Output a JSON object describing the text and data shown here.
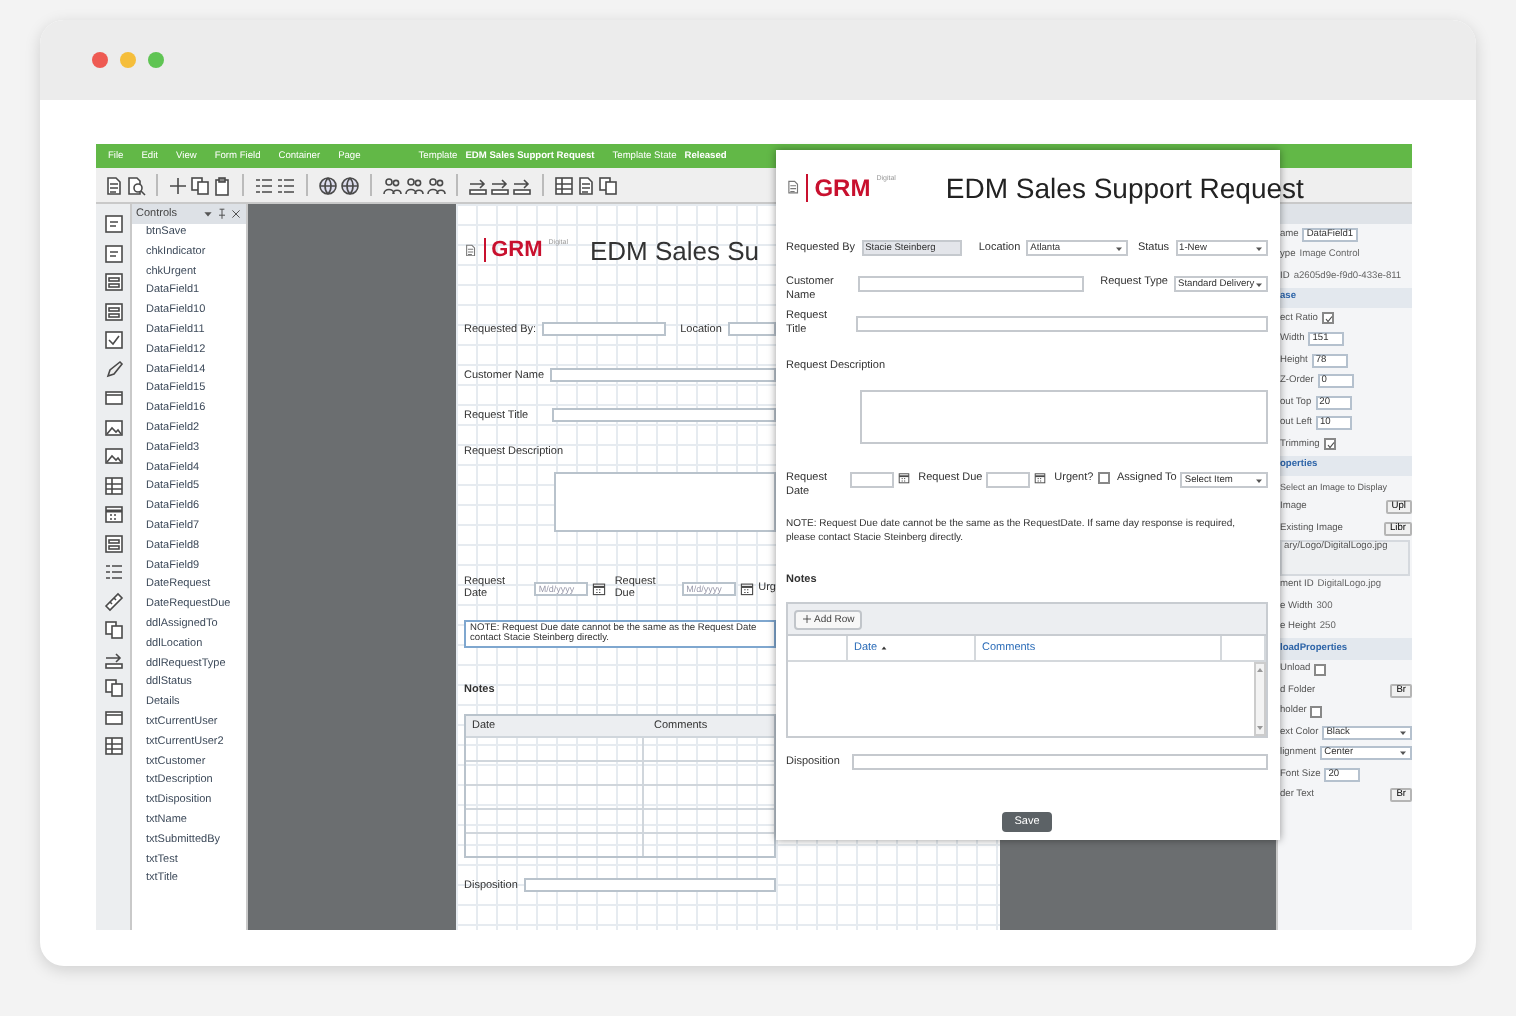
{
  "browser": {
    "dots": [
      {
        "color": "#ee5a52"
      },
      {
        "color": "#f5be3b"
      },
      {
        "color": "#5fc453"
      }
    ]
  },
  "menu_bar": {
    "items": [
      "File",
      "Edit",
      "View",
      "Form Field",
      "Container",
      "Page"
    ],
    "template_label": "Template",
    "template_name": "EDM Sales Support Request",
    "state_label": "Template State",
    "state_value": "Released"
  },
  "controls_panel": {
    "title": "Controls",
    "items": [
      "btnSave",
      "chkIndicator",
      "chkUrgent",
      "DataField1",
      "DataField10",
      "DataField11",
      "DataField12",
      "DataField14",
      "DataField15",
      "DataField16",
      "DataField2",
      "DataField3",
      "DataField4",
      "DataField5",
      "DataField6",
      "DataField7",
      "DataField8",
      "DataField9",
      "DateRequest",
      "DateRequestDue",
      "ddlAssignedTo",
      "ddlLocation",
      "ddlRequestType",
      "ddlStatus",
      "Details",
      "txtCurrentUser",
      "txtCurrentUser2",
      "txtCustomer",
      "txtDescription",
      "txtDisposition",
      "txtName",
      "txtSubmittedBy",
      "txtTest",
      "txtTitle"
    ]
  },
  "form": {
    "logo": {
      "brand": "GRM",
      "tag": "Digital"
    },
    "title": "EDM Sales Su",
    "requested_by_label": "Requested By:",
    "location_label": "Location",
    "customer_label": "Customer Name",
    "title_label": "Request Title",
    "description_label": "Request Description",
    "date_label": "Request Date",
    "date_placeholder": "M/d/yyyy",
    "due_label": "Request Due",
    "due_placeholder": "M/d/yyyy",
    "urgent_label": "Urg",
    "note_lines": [
      "NOTE: Request Due date cannot be the same as the Request Date",
      "contact Stacie Steinberg directly."
    ],
    "notes_label": "Notes",
    "columns": [
      "Date",
      "Comments"
    ],
    "disposition_label": "Disposition"
  },
  "dialog": {
    "logo": {
      "brand": "GRM",
      "tag": "Digital"
    },
    "title": "EDM Sales Support Request",
    "requested_by": {
      "label": "Requested By",
      "value": "Stacie Steinberg",
      "disabled": true
    },
    "location": {
      "label": "Location",
      "value": "Atlanta"
    },
    "status": {
      "label": "Status",
      "value": "1-New"
    },
    "customer_name": {
      "label": "Customer Name"
    },
    "request_type": {
      "label": "Request Type",
      "value": "Standard Delivery"
    },
    "request_title": {
      "label": "Request Title"
    },
    "request_description": {
      "label": "Request Description"
    },
    "request_date": {
      "label": "Request Date"
    },
    "request_due": {
      "label": "Request Due"
    },
    "urgent": {
      "label": "Urgent?",
      "checked": false
    },
    "assigned_to": {
      "label": "Assigned To",
      "value": "Select Item"
    },
    "note": "NOTE: Request Due date cannot be the same as the RequestDate. If same day response is required, please contact Stacie Steinberg directly.",
    "notes_label": "Notes",
    "add_row": "Add Row",
    "columns": [
      {
        "label": "Date",
        "sorted": true
      },
      {
        "label": "Comments",
        "sorted": false
      }
    ],
    "disposition_label": "Disposition",
    "save": "Save"
  },
  "properties": {
    "rows": [
      {
        "kind": "field",
        "label": "ame",
        "value": "DataField1"
      },
      {
        "kind": "text",
        "label": "ype",
        "value": "Image Control"
      },
      {
        "kind": "text",
        "label": "ID",
        "value": "a2605d9e-f9d0-433e-811"
      },
      {
        "kind": "section",
        "label": "ase"
      },
      {
        "kind": "check",
        "label": "ect Ratio",
        "checked": true
      },
      {
        "kind": "field",
        "label": "Width",
        "value": "151"
      },
      {
        "kind": "field",
        "label": "Height",
        "value": "78"
      },
      {
        "kind": "field",
        "label": "Z-Order",
        "value": "0"
      },
      {
        "kind": "field",
        "label": "out Top",
        "value": "20"
      },
      {
        "kind": "field",
        "label": "out Left",
        "value": "10"
      },
      {
        "kind": "check",
        "label": "Trimming",
        "checked": true
      },
      {
        "kind": "section",
        "label": "operties"
      },
      {
        "kind": "note",
        "label": "Select an Image to Display"
      },
      {
        "kind": "button",
        "label": "Image",
        "value": "Upl"
      },
      {
        "kind": "button",
        "label": "Existing Image",
        "value": "Libr"
      },
      {
        "kind": "path",
        "value": "ary/Logo/DigitalLogo.jpg"
      },
      {
        "kind": "text",
        "label": "ment ID",
        "value": "DigitalLogo.jpg"
      },
      {
        "kind": "text",
        "label": "e Width",
        "value": "300"
      },
      {
        "kind": "text",
        "label": "e Height",
        "value": "250"
      },
      {
        "kind": "section",
        "label": "loadProperties"
      },
      {
        "kind": "check",
        "label": "Unload",
        "checked": false
      },
      {
        "kind": "button",
        "label": "d Folder",
        "value": "Br"
      },
      {
        "kind": "check",
        "label": "holder",
        "checked": false
      },
      {
        "kind": "select",
        "label": "ext Color",
        "value": "Black"
      },
      {
        "kind": "select",
        "label": "lignment",
        "value": "Center"
      },
      {
        "kind": "field",
        "label": "Font Size",
        "value": "20"
      },
      {
        "kind": "button",
        "label": "der Text",
        "value": "Br"
      }
    ]
  }
}
